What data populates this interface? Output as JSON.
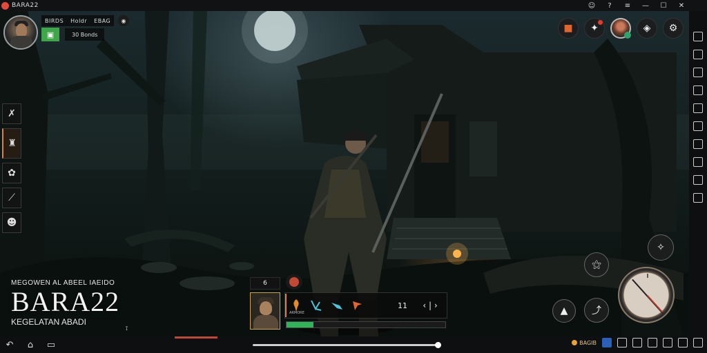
{
  "window": {
    "title": "BARA22",
    "controls": {
      "minimize": "—",
      "maximize": "☐",
      "close": "✕"
    }
  },
  "hud": {
    "top_left_labels": [
      "BIRDS",
      "Holdr",
      "EBAG"
    ],
    "bonus_label": "30 Bonds",
    "level": "6"
  },
  "hotbar": {
    "slot_label": "ARMORE",
    "item_count": "11",
    "health_fraction": 0.17
  },
  "title": {
    "subtitle_top": "MEGOWEN AL ABEEL IAEIDO",
    "main": "BARA22",
    "subtitle_bottom": "KEGELATAN ABADI",
    "mark": "ɪ̃"
  },
  "bottombar": {
    "progress_fraction": 0.99,
    "badge_text": "BAGIB"
  },
  "colors": {
    "accent_orange": "#d9862e",
    "health_green": "#2fb45a",
    "notification_red": "#e23b2e",
    "bonus_green": "#3fa64a"
  },
  "icons": {
    "top_right": [
      "backpack-icon",
      "sword-alert-icon",
      "hero-avatar-icon",
      "shield-icon",
      "settings-gear-icon"
    ],
    "left_skills": [
      "crossed-swords-icon",
      "armor-icon",
      "leaf-icon",
      "feather-icon",
      "emote-icon"
    ],
    "bottom_right": [
      "dash-icon",
      "special-icon",
      "interact-icon",
      "jump-icon",
      "attack-compass-icon"
    ]
  }
}
